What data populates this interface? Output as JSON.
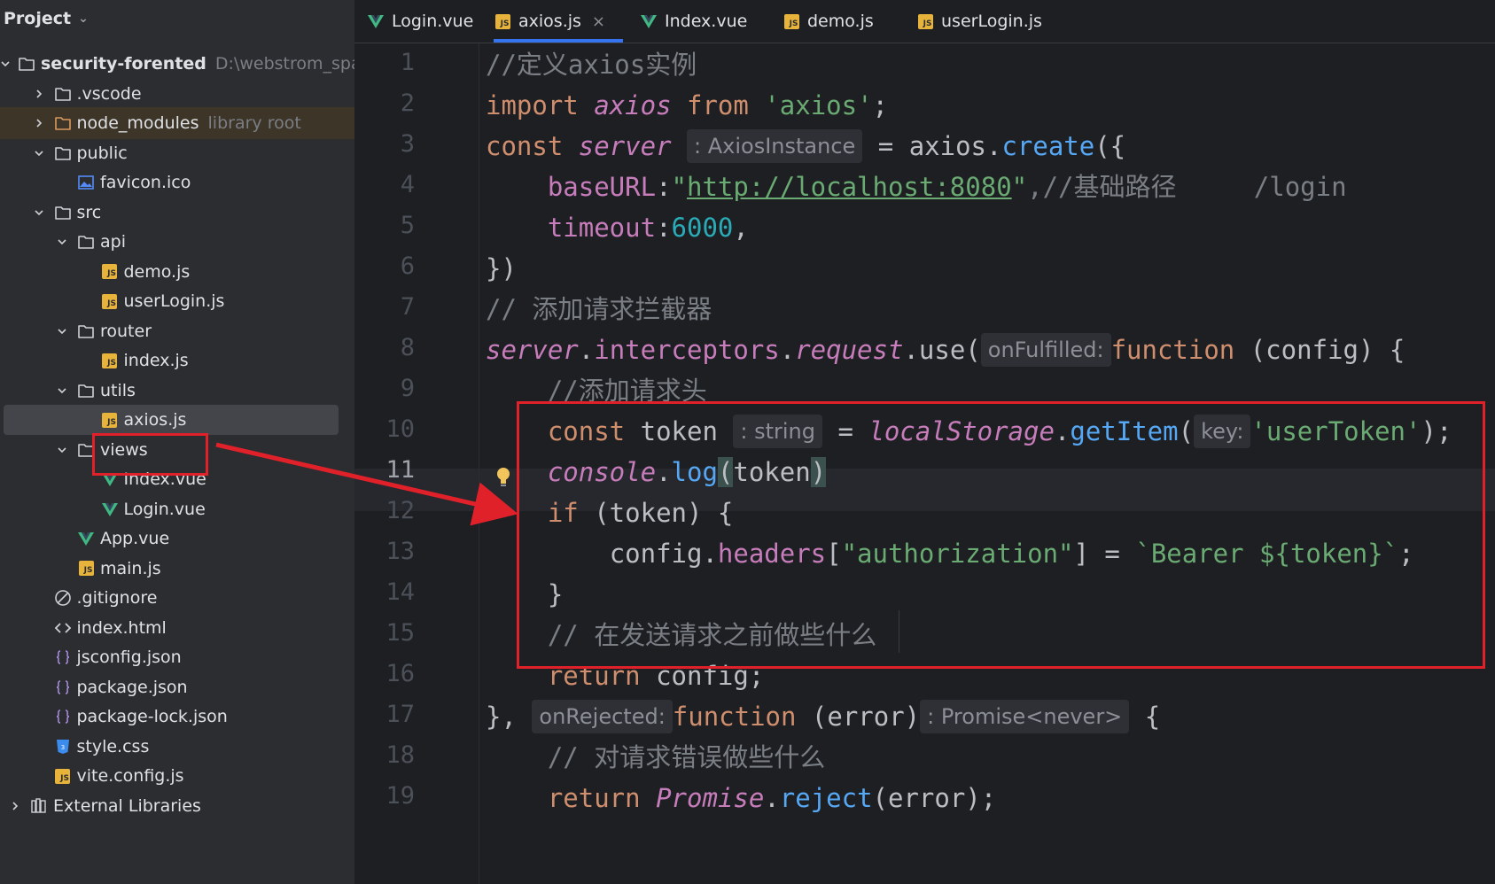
{
  "sidebar": {
    "header": "Project",
    "items": [
      {
        "label": "security-forented",
        "hint": "D:\\webstrom_space\\",
        "kind": "folder",
        "arrow": "down",
        "bold": true
      },
      {
        "label": ".vscode",
        "kind": "folder",
        "arrow": "right"
      },
      {
        "label": "node_modules",
        "hint": "library root",
        "kind": "folder-lib",
        "arrow": "right"
      },
      {
        "label": "public",
        "kind": "folder",
        "arrow": "down"
      },
      {
        "label": "favicon.ico",
        "kind": "image"
      },
      {
        "label": "src",
        "kind": "folder",
        "arrow": "down"
      },
      {
        "label": "api",
        "kind": "folder",
        "arrow": "down"
      },
      {
        "label": "demo.js",
        "kind": "js"
      },
      {
        "label": "userLogin.js",
        "kind": "js"
      },
      {
        "label": "router",
        "kind": "folder",
        "arrow": "down"
      },
      {
        "label": "index.js",
        "kind": "js"
      },
      {
        "label": "utils",
        "kind": "folder",
        "arrow": "down"
      },
      {
        "label": "axios.js",
        "kind": "js",
        "selected": true
      },
      {
        "label": "views",
        "kind": "folder",
        "arrow": "down"
      },
      {
        "label": "Index.vue",
        "kind": "vue"
      },
      {
        "label": "Login.vue",
        "kind": "vue"
      },
      {
        "label": "App.vue",
        "kind": "vue"
      },
      {
        "label": "main.js",
        "kind": "js"
      },
      {
        "label": ".gitignore",
        "kind": "ignore"
      },
      {
        "label": "index.html",
        "kind": "html"
      },
      {
        "label": "jsconfig.json",
        "kind": "json"
      },
      {
        "label": "package.json",
        "kind": "json"
      },
      {
        "label": "package-lock.json",
        "kind": "json"
      },
      {
        "label": "style.css",
        "kind": "css"
      },
      {
        "label": "vite.config.js",
        "kind": "js"
      },
      {
        "label": "External Libraries",
        "kind": "libs",
        "arrow": "right"
      }
    ]
  },
  "tabs": [
    {
      "label": "Login.vue",
      "kind": "vue"
    },
    {
      "label": "axios.js",
      "kind": "js",
      "active": true
    },
    {
      "label": "Index.vue",
      "kind": "vue"
    },
    {
      "label": "demo.js",
      "kind": "js"
    },
    {
      "label": "userLogin.js",
      "kind": "js"
    }
  ],
  "editor": {
    "current_line": 11,
    "line_numbers": [
      "1",
      "2",
      "3",
      "4",
      "5",
      "6",
      "7",
      "8",
      "9",
      "10",
      "11",
      "12",
      "13",
      "14",
      "15",
      "16",
      "17",
      "18",
      "19"
    ],
    "inlays": {
      "server_type": ": AxiosInstance",
      "on_fulfilled": "onFulfilled:",
      "token_type": ": string",
      "key": "key:",
      "on_rejected": "onRejected:",
      "promise_type": ": Promise<never>"
    },
    "tokens": {
      "l1_comment": "//定义axios实例",
      "kw_import": "import",
      "id_axios": "axios",
      "kw_from": "from",
      "str_axios": "'axios'",
      "semi": ";",
      "kw_const": "const",
      "id_server": "server",
      "eq": " = ",
      "axios_dot": "axios.",
      "fn_create": "create",
      "open_obj": "({",
      "prop_baseurl": "baseURL",
      "colon": ":",
      "quote": "\"",
      "url": "http://localhost:8080",
      "l4_comment": ",//基础路径     /login",
      "prop_timeout": "timeout",
      "num_6000": "6000",
      "comma": ",",
      "close_obj": "})",
      "l7_comment": "// 添加请求拦截器",
      "dot": ".",
      "interceptors": "interceptors",
      "request": "request",
      "use": "use",
      "open_paren": "(",
      "kw_function": "function",
      "config_param": " (config) {",
      "l9_comment": "//添加请求头",
      "id_token": " token",
      "localstorage": "localStorage",
      "getitem": "getItem",
      "str_usertoken": "'userToken'",
      "close_semi": ");",
      "console": "console",
      "log": "log",
      "paren_token_open": "(",
      "token_arg": "token",
      "paren_token_close": ")",
      "kw_if": "if",
      "if_cond": " (token) {",
      "config_dot": "config.",
      "headers": "headers",
      "bracket_open": "[",
      "str_auth": "\"authorization\"",
      "bracket_close": "]",
      "template": "`Bearer ${token}`",
      "close_brace": "}",
      "l15_comment": "// 在发送请求之前做些什么",
      "kw_return": "return",
      "return_config": " config;",
      "close_comma": "},",
      "error_param": " (error)",
      "open_brace": " {",
      "l18_comment": "// 对请求错误做些什么",
      "promise": "Promise",
      "reject": "reject",
      "reject_args": "(error);"
    }
  }
}
